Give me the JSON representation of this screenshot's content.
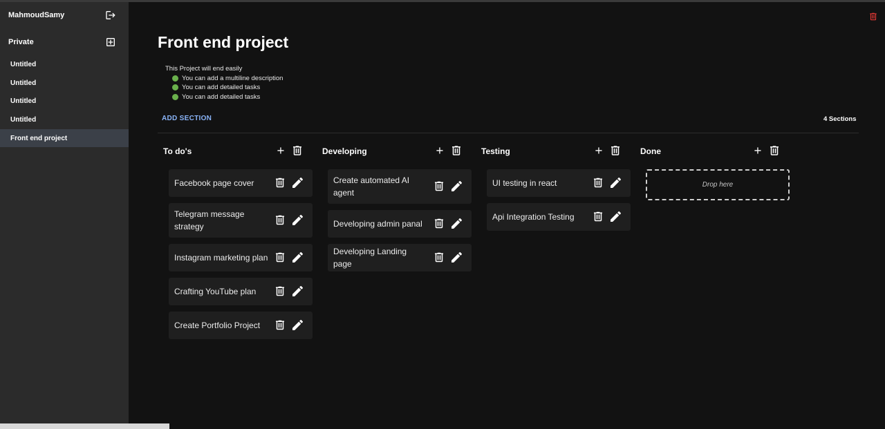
{
  "sidebar": {
    "username": "MahmoudSamy",
    "section_label": "Private",
    "items": [
      {
        "label": "Untitled"
      },
      {
        "label": "Untitled"
      },
      {
        "label": "Untitled"
      },
      {
        "label": "Untitled"
      },
      {
        "label": "Front end project",
        "active": true
      }
    ]
  },
  "project": {
    "title": "Front end project",
    "description": "This Project will end easily",
    "bullets": [
      "You can add a multiline description",
      "You can add detailed tasks",
      "You can add detailed tasks"
    ],
    "add_section_label": "ADD SECTION",
    "sections_count": "4 Sections"
  },
  "columns": [
    {
      "title": "To do's",
      "cards": [
        "Facebook page cover",
        "Telegram message strategy",
        "Instagram marketing plan",
        "Crafting YouTube plan",
        "Create Portfolio Project"
      ]
    },
    {
      "title": "Developing",
      "cards": [
        "Create automated AI agent",
        "Developing admin panal",
        "Developing Landing page"
      ]
    },
    {
      "title": "Testing",
      "cards": [
        "UI testing in react",
        "Api Integration Testing"
      ]
    },
    {
      "title": "Done",
      "cards": [],
      "drop_label": "Drop here"
    }
  ],
  "colors": {
    "accent": "#8ab4f8",
    "danger": "#e53935",
    "bullet": "#6ab04c",
    "sidebar_bg": "#2b2b2b",
    "main_bg": "#121212",
    "card_bg": "#1f1f1f"
  }
}
